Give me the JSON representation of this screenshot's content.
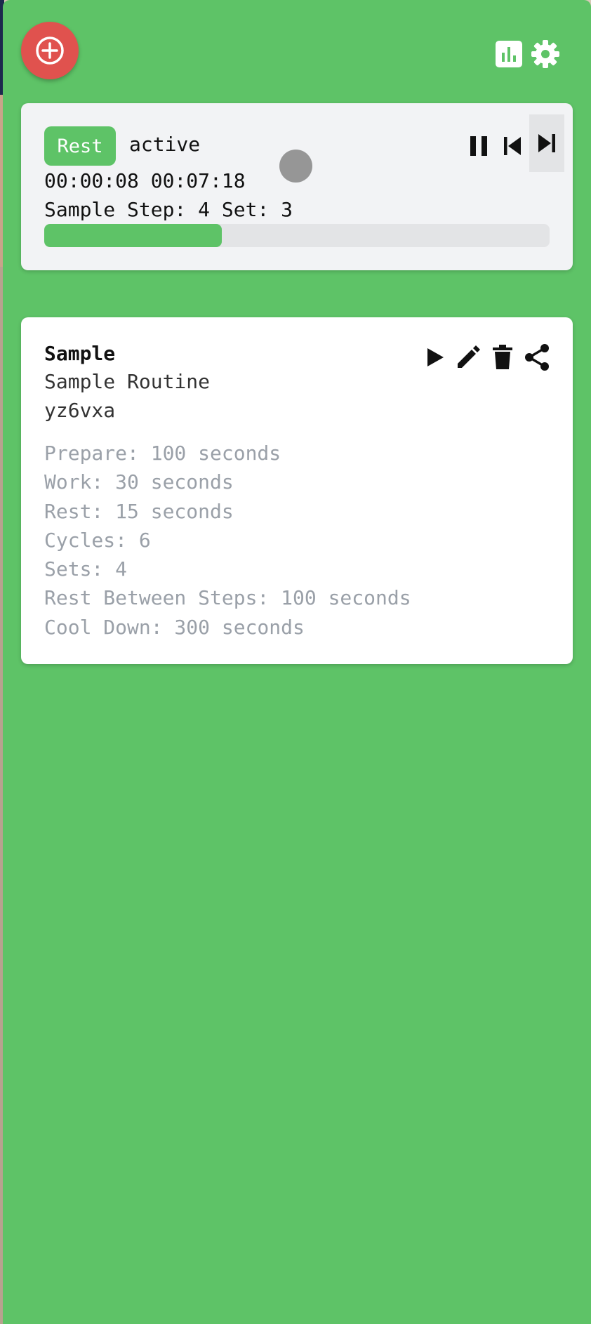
{
  "timer": {
    "phase": "Rest",
    "status": "active",
    "elapsed": "00:00:08",
    "remaining": "00:07:18",
    "step_line": "Sample Step: 4 Set: 3",
    "progress_fraction": 0.352
  },
  "routine": {
    "name": "Sample",
    "description": "Sample Routine",
    "code": "yz6vxa",
    "details": [
      "Prepare: 100 seconds",
      "Work: 30 seconds",
      "Rest: 15 seconds",
      "Cycles: 6",
      "Sets: 4",
      "Rest Between Steps: 100 seconds",
      "Cool Down: 300 seconds"
    ]
  },
  "icons": {
    "add": "plus-circle-icon",
    "stats": "bar-chart-icon",
    "settings": "gear-icon",
    "pause": "pause-icon",
    "previous": "skip-previous-icon",
    "next": "skip-next-icon",
    "play": "play-icon",
    "edit": "pencil-icon",
    "delete": "trash-icon",
    "share": "share-icon"
  },
  "colors": {
    "background": "#5ec367",
    "accent": "#5ec367",
    "add_button": "#e0524e",
    "card": "#ffffff",
    "timer_card": "#f2f3f5",
    "muted_text": "#9aa0a8"
  }
}
